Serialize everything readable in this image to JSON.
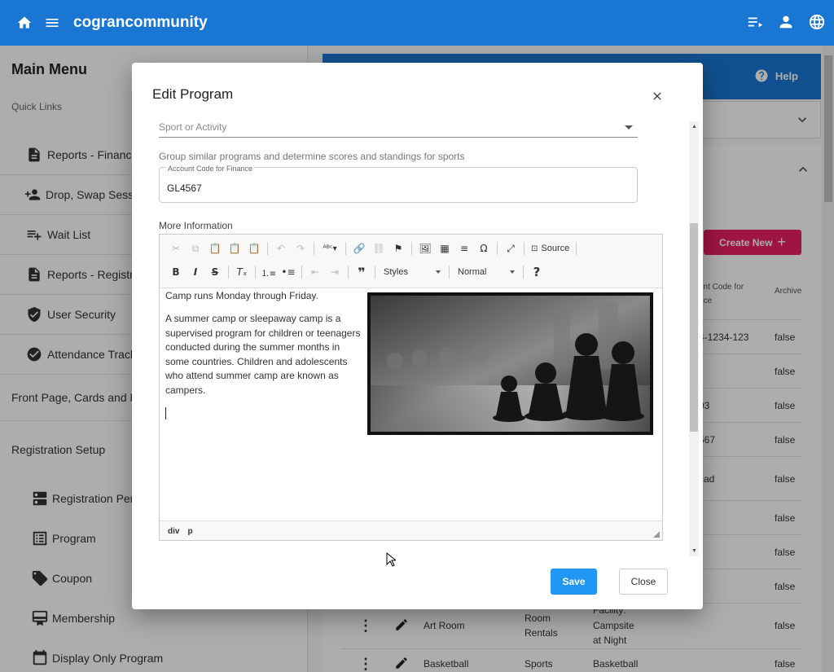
{
  "app": {
    "title": "cograncommunity"
  },
  "sidebar": {
    "title": "Main Menu",
    "quick_links_label": "Quick Links",
    "quick_links": [
      {
        "label": "Reports - Finance",
        "icon": "description-icon"
      },
      {
        "label": "Drop, Swap Sess",
        "icon": "person-add-icon"
      },
      {
        "label": "Wait List",
        "icon": "playlist-add-icon"
      },
      {
        "label": "Reports - Registra",
        "icon": "description-icon"
      },
      {
        "label": "User Security",
        "icon": "shield-check-icon"
      },
      {
        "label": "Attendance Track",
        "icon": "check-circle-icon"
      }
    ],
    "front_page_label": "Front Page, Cards and M",
    "registration_setup_label": "Registration Setup",
    "registration_items": [
      {
        "label": "Registration Per",
        "icon": "dns-icon"
      },
      {
        "label": "Program",
        "icon": "list-alt-icon"
      },
      {
        "label": "Coupon",
        "icon": "tag-icon"
      },
      {
        "label": "Membership",
        "icon": "card-membership-icon"
      },
      {
        "label": "Display Only Program",
        "icon": "calendar-icon"
      }
    ]
  },
  "main": {
    "help_label": "Help",
    "create_new_label": "Create New",
    "col_account": "unt Code for",
    "col_account2": "nce",
    "col_archive": "Archive",
    "rows": [
      {
        "acct": "4-1234-123",
        "archive": "false"
      },
      {
        "acct": "",
        "archive": "false"
      },
      {
        "acct": "03",
        "archive": "false"
      },
      {
        "acct": "567",
        "archive": "false"
      },
      {
        "acct": "cad",
        "archive": "false"
      },
      {
        "acct": "",
        "archive": "false"
      },
      {
        "acct": "",
        "archive": "false"
      },
      {
        "acct": "",
        "archive": "false"
      }
    ],
    "bottom_rows": [
      {
        "name": "Art Room",
        "category_line1": "Room",
        "category_line2": "Rentals",
        "facility_line1": "Facility:",
        "facility_line2": "Campsite",
        "facility_line3": "at Night",
        "archive": "false"
      },
      {
        "name": "Basketball",
        "category_line1": "Sports",
        "facility_line1": "Basketball",
        "archive": "false"
      }
    ]
  },
  "dialog": {
    "title": "Edit Program",
    "sport_placeholder": "Sport or Activity",
    "hint": "Group similar programs and determine scores and standings for sports",
    "account_label": "Account Code for Finance",
    "account_value": "GL4567",
    "more_info_label": "More Information",
    "toolbar": {
      "source_label": "Source",
      "styles_label": "Styles",
      "format_label": "Normal"
    },
    "content": {
      "p1": "Camp runs Monday through Friday.",
      "p2": "A summer camp or sleepaway camp is a supervised program for children or teenagers conducted during the summer months in some countries. Children and adolescents who attend summer camp are known as campers."
    },
    "status_path": [
      "div",
      "p"
    ],
    "save_label": "Save",
    "close_label": "Close"
  }
}
